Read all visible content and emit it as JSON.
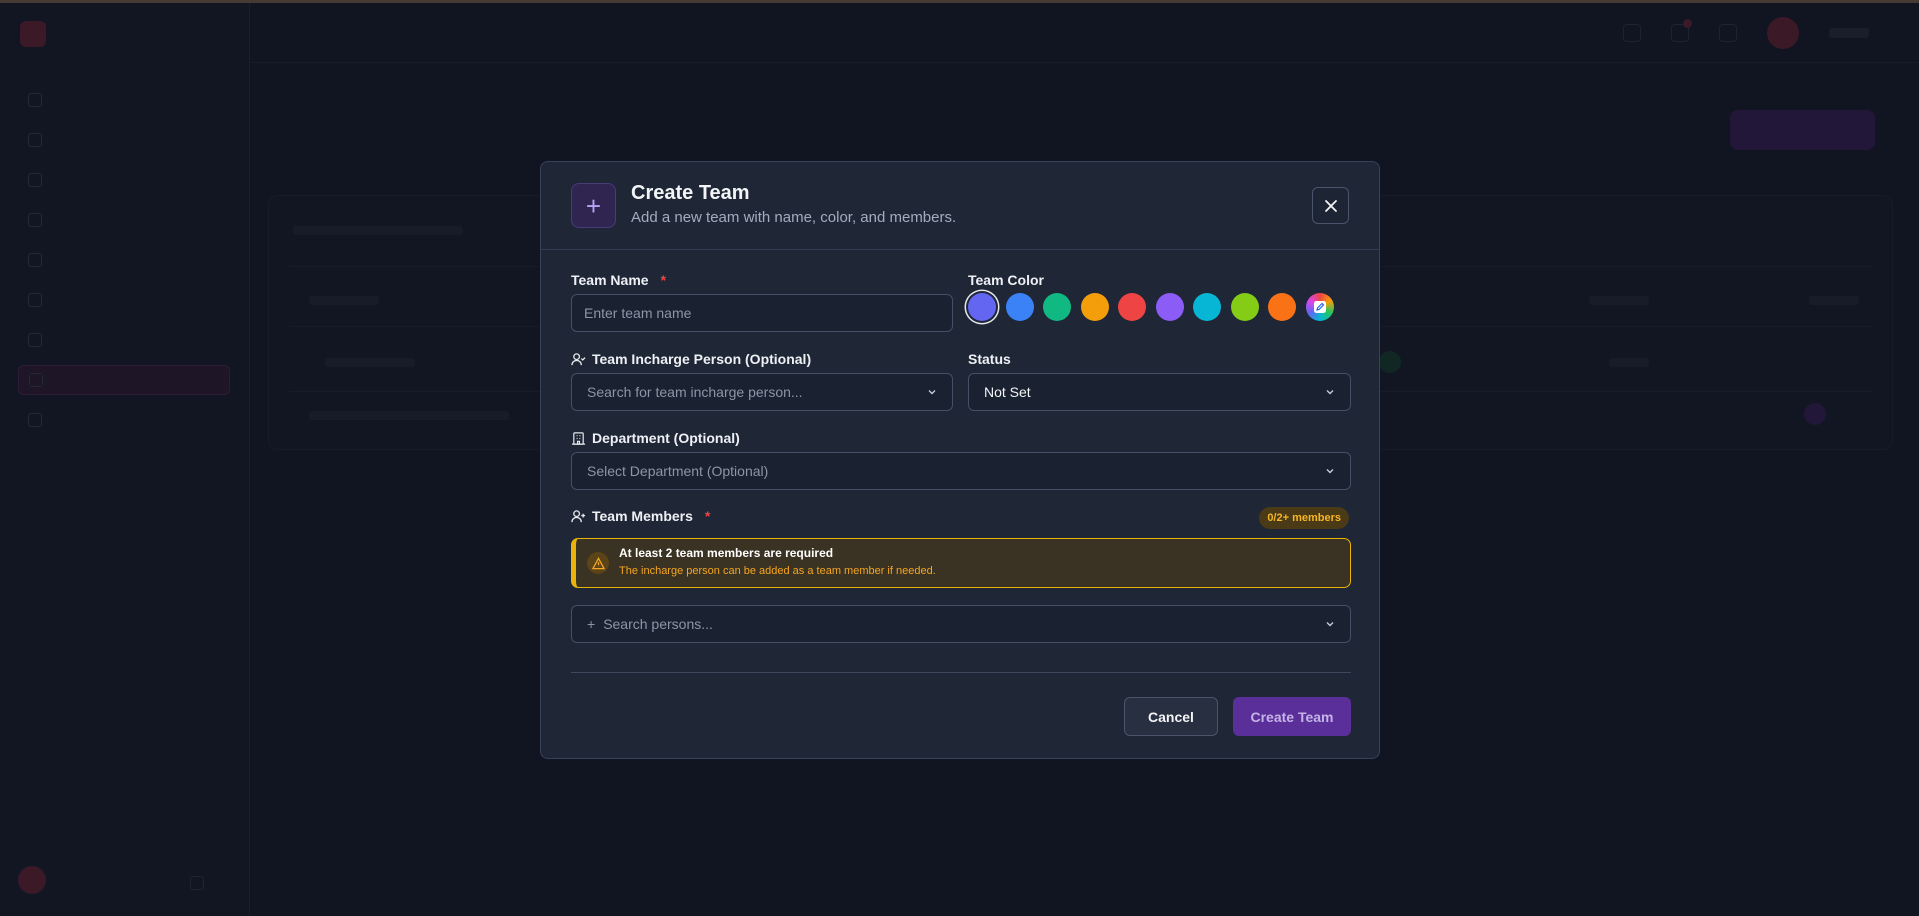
{
  "modal": {
    "title": "Create Team",
    "subtitle": "Add a new team with name, color, and members.",
    "team_name": {
      "label": "Team Name",
      "required_mark": "*",
      "placeholder": "Enter team name"
    },
    "team_color": {
      "label": "Team Color",
      "swatches": [
        "#6366f1",
        "#3b82f6",
        "#10b981",
        "#f59e0b",
        "#ef4444",
        "#8b5cf6",
        "#06b6d4",
        "#84cc16",
        "#f97316"
      ],
      "selected_index": 0,
      "custom_icon": "edit-icon"
    },
    "incharge": {
      "label": "Team Incharge Person (Optional)",
      "placeholder": "Search for team incharge person...",
      "icon": "user-check-icon"
    },
    "status": {
      "label": "Status",
      "value": "Not Set"
    },
    "department": {
      "label": "Department (Optional)",
      "placeholder": "Select Department (Optional)",
      "icon": "building-icon"
    },
    "members": {
      "label": "Team Members",
      "required_mark": "*",
      "count_badge": "0/2+ members",
      "alert_title": "At least 2 team members are required",
      "alert_message": "The incharge person can be added as a team member if needed.",
      "search_placeholder": "Search persons..."
    },
    "cancel_label": "Cancel",
    "create_label": "Create Team",
    "colors": {
      "accent": "#5b2f9a",
      "warning": "#eab308",
      "required": "#ef4444"
    }
  }
}
